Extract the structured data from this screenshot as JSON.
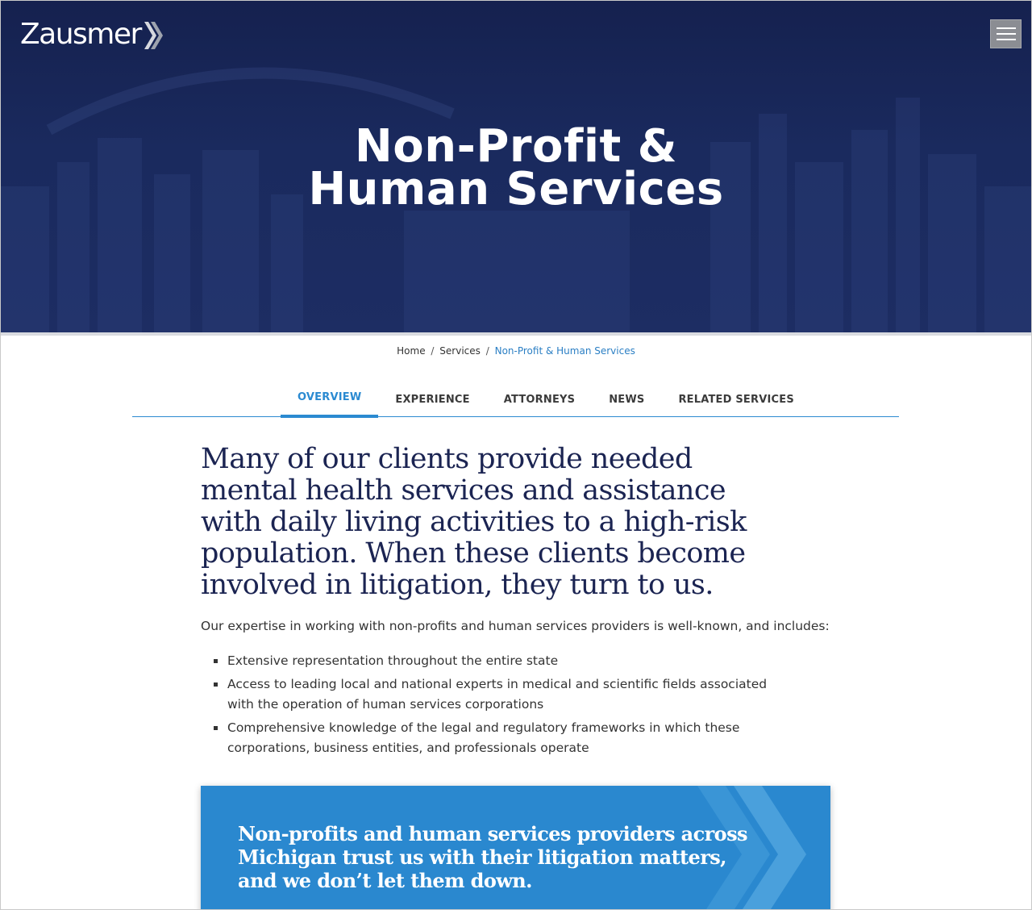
{
  "header": {
    "logo_text": "Zausmer",
    "menu_icon": "hamburger-icon"
  },
  "hero": {
    "title_line1": "Non-Profit &",
    "title_line2": "Human Services"
  },
  "breadcrumb": {
    "home": "Home",
    "separator": "/",
    "services": "Services",
    "current": "Non-Profit & Human Services"
  },
  "tabs": [
    {
      "label": "OVERVIEW",
      "active": true
    },
    {
      "label": "EXPERIENCE",
      "active": false
    },
    {
      "label": "ATTORNEYS",
      "active": false
    },
    {
      "label": "NEWS",
      "active": false
    },
    {
      "label": "RELATED SERVICES",
      "active": false
    }
  ],
  "content": {
    "lead": "Many of our clients provide needed mental health services and assistance with daily living activities to a high-risk population. When these clients become involved in litigation, they turn to us.",
    "intro": "Our expertise in working with non-profits and human services providers is well-known, and includes:",
    "bullets": [
      "Extensive representation throughout the entire state",
      "Access to leading local and national experts in medical and scientific fields associated with the operation of human services corporations",
      "Comprehensive knowledge of the legal and regulatory frameworks in which these corporations, business entities, and professionals operate"
    ],
    "callout": "Non-profits and human services providers across Michigan trust us with their litigation matters, and we don’t let them down."
  },
  "colors": {
    "hero_bg": "#1a2a5e",
    "accent_blue": "#2b8ad1",
    "callout_bg": "#2a88cf",
    "lead_text": "#1b2452"
  }
}
